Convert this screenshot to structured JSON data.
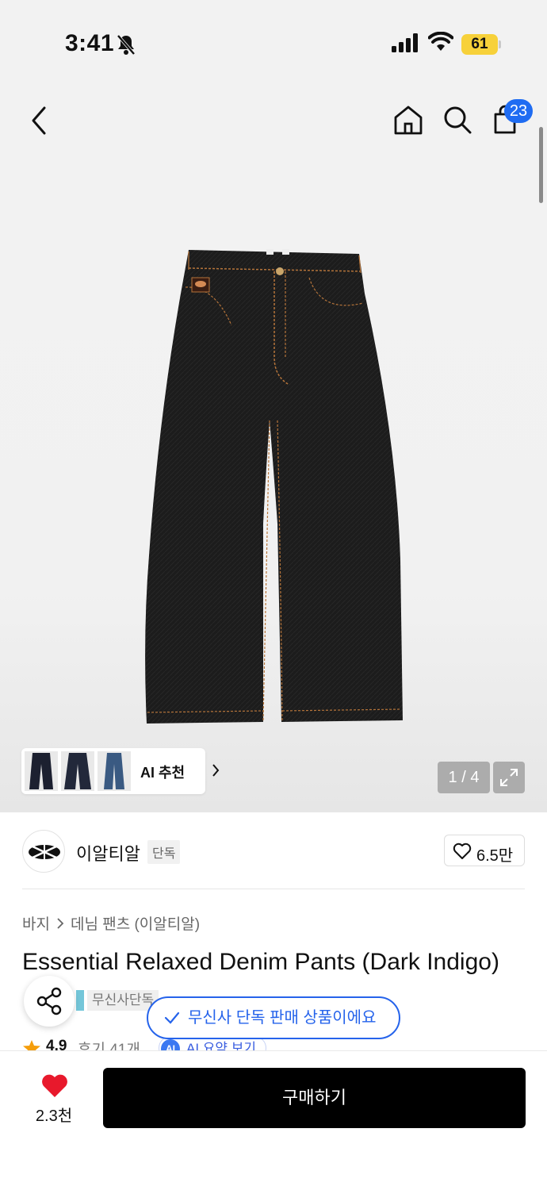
{
  "status_bar": {
    "time": "3:41",
    "battery": "61"
  },
  "header": {
    "cart_count": "23"
  },
  "gallery": {
    "ai_recommend_label": "AI 추천",
    "page_counter": "1 / 4"
  },
  "brand": {
    "name": "이알티알",
    "exclusive_tag": "단독",
    "likes": "6.5만"
  },
  "breadcrumb": {
    "category": "바지",
    "subcategory": "데님 팬츠 (이알티알)"
  },
  "product": {
    "title": "Essential Relaxed Denim Pants (Dark Indigo)"
  },
  "tags": {
    "exclusive_tag": "무신사단독"
  },
  "toast": {
    "message": "무신사 단독 판매 상품이에요"
  },
  "rating": {
    "score": "4.9",
    "reviews": "후기 41개",
    "ai_summary": "AI 요약 보기",
    "ai_badge": "AI"
  },
  "bottom_bar": {
    "wish_count": "2.3천",
    "buy_label": "구매하기"
  },
  "colors": {
    "accent_blue": "#2563eb",
    "badge_blue": "#1f6cf2",
    "heart_red": "#e8192c",
    "star_orange": "#f59e0b"
  }
}
